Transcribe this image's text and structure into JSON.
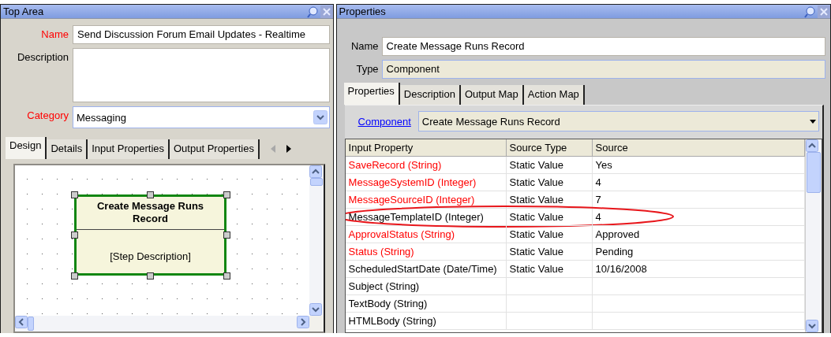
{
  "left_panel": {
    "title": "Top Area",
    "fields": [
      {
        "label": "Name",
        "required": true,
        "kind": "text",
        "value": "Send Discussion Forum Email Updates - Realtime"
      },
      {
        "label": "Description",
        "required": false,
        "kind": "textarea"
      },
      {
        "label": "Category",
        "required": true,
        "kind": "dropdown",
        "value": "Messaging"
      }
    ],
    "tabs": [
      {
        "label": "Design",
        "selected": true
      },
      {
        "label": "Details",
        "selected": false
      },
      {
        "label": "Input Properties",
        "selected": false
      },
      {
        "label": "Output Properties",
        "selected": false
      }
    ],
    "canvas": {
      "node": {
        "title": "Create Message Runs Record",
        "description": "[Step Description]",
        "selected": true
      }
    }
  },
  "right_panel": {
    "title": "Properties",
    "fields": [
      {
        "label": "Name",
        "kind": "text",
        "value": "Create Message Runs Record"
      },
      {
        "label": "Type",
        "kind": "readonly",
        "value": "Component"
      }
    ],
    "tabs": [
      {
        "label": "Properties",
        "selected": true
      },
      {
        "label": "Description",
        "selected": false
      },
      {
        "label": "Output Map",
        "selected": false
      },
      {
        "label": "Action Map",
        "selected": false
      }
    ],
    "component": {
      "label": "Component",
      "value": "Create Message Runs Record"
    },
    "table": {
      "columns": [
        "Input Property",
        "Source Type",
        "Source"
      ],
      "rows": [
        {
          "property": "SaveRecord (String)",
          "source_type": "Static Value",
          "source": "Yes",
          "required": true,
          "highlighted": false
        },
        {
          "property": "MessageSystemID (Integer)",
          "source_type": "Static Value",
          "source": "4",
          "required": true,
          "highlighted": false
        },
        {
          "property": "MessageSourceID (Integer)",
          "source_type": "Static Value",
          "source": "7",
          "required": true,
          "highlighted": false
        },
        {
          "property": "MessageTemplateID (Integer)",
          "source_type": "Static Value",
          "source": "4",
          "required": false,
          "highlighted": true
        },
        {
          "property": "ApprovalStatus (String)",
          "source_type": "Static Value",
          "source": "Approved",
          "required": true,
          "highlighted": false
        },
        {
          "property": "Status (String)",
          "source_type": "Static Value",
          "source": "Pending",
          "required": true,
          "highlighted": false
        },
        {
          "property": "ScheduledStartDate (Date/Time)",
          "source_type": "Static Value",
          "source": "10/16/2008",
          "required": false,
          "highlighted": false
        },
        {
          "property": "Subject (String)",
          "required": false,
          "highlighted": false
        },
        {
          "property": "TextBody (String)",
          "required": false,
          "highlighted": false
        },
        {
          "property": "HTMLBody (String)",
          "required": false,
          "highlighted": false
        }
      ]
    }
  }
}
